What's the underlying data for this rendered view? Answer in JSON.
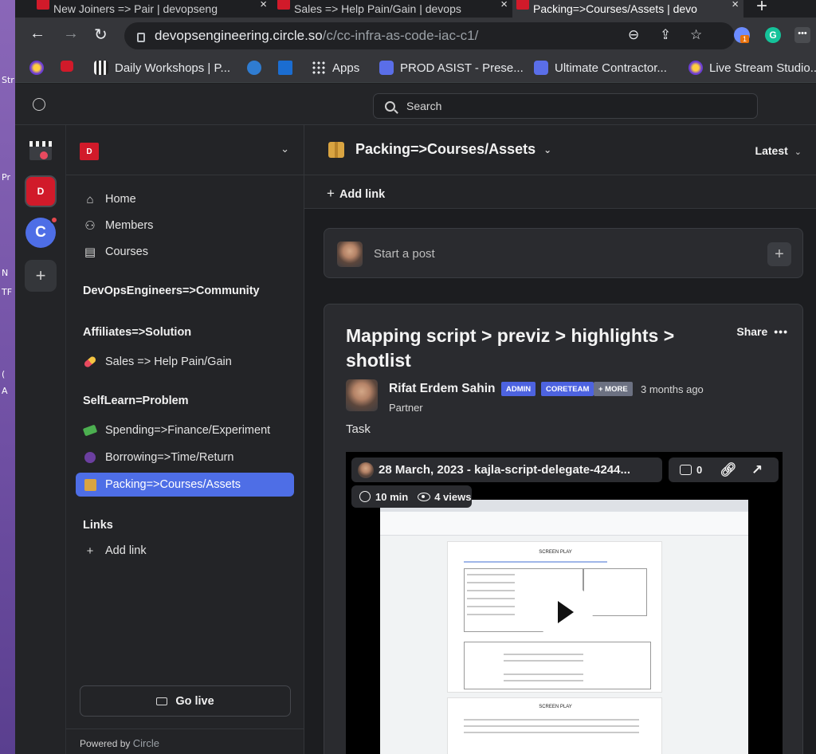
{
  "desktop": {
    "fragments": [
      "Str",
      "Pr",
      "N",
      "TF",
      "(",
      "A"
    ]
  },
  "browser": {
    "tabs": [
      {
        "label": "New Joiners => Pair | devopseng",
        "active": false
      },
      {
        "label": "Sales => Help Pain/Gain | devops",
        "active": false
      },
      {
        "label": "Packing=>Courses/Assets | devo",
        "active": true
      }
    ],
    "url_host": "devopsengineering.circle.so",
    "url_path": "/c/cc-infra-as-code-iac-c1/",
    "bookmarks": [
      {
        "label": "",
        "icon": "youtube-red"
      },
      {
        "label": "Daily Workshops | P...",
        "icon": "clapperboard"
      },
      {
        "label": "",
        "icon": "wordpress"
      },
      {
        "label": "",
        "icon": "blue-square"
      },
      {
        "label": "Apps",
        "icon": "apps-grid"
      },
      {
        "label": "PROD ASIST - Prese...",
        "icon": "bot"
      },
      {
        "label": "Ultimate Contractor...",
        "icon": "bot"
      },
      {
        "label": "Live Stream Studio...",
        "icon": "rocket"
      }
    ],
    "extension_badge": "1"
  },
  "app": {
    "search_label": "Search",
    "rail": [
      {
        "name": "clapper-community",
        "label": ""
      },
      {
        "name": "devops-community",
        "label": ""
      },
      {
        "name": "c-community",
        "label": "C"
      },
      {
        "name": "add-community",
        "label": "+"
      }
    ],
    "sidebar": {
      "nav": [
        {
          "label": "Home",
          "icon": "home-icon"
        },
        {
          "label": "Members",
          "icon": "members-icon"
        },
        {
          "label": "Courses",
          "icon": "courses-icon"
        }
      ],
      "community_title": "DevOpsEngineers=>Community",
      "affiliates_title": "Affiliates=>Solution",
      "sales_item": "Sales => Help Pain/Gain",
      "selflearn_title": "SelfLearn=Problem",
      "spending_item": "Spending=>Finance/Experiment",
      "borrowing_item": "Borrowing=>Time/Return",
      "packing_item": "Packing=>Courses/Assets",
      "links_title": "Links",
      "add_link": "Add link",
      "go_live": "Go live",
      "powered_prefix": "Powered by",
      "powered_brand": "Circle"
    },
    "main": {
      "space_title": "Packing=>Courses/Assets",
      "sort_label": "Latest",
      "add_link": "Add link",
      "composer_placeholder": "Start a post",
      "post": {
        "title": "Mapping script > previz > highlights > shotlist",
        "share_label": "Share",
        "author": "Rifat Erdem Sahin",
        "badges": {
          "admin": "ADMIN",
          "core": "CORETEAM",
          "more": "+ MORE"
        },
        "time_ago": "3 months ago",
        "role": "Partner",
        "body": "Task",
        "video": {
          "title": "28 March, 2023 - kajla-script-delegate-4244...",
          "comments": "0",
          "duration": "10 min",
          "views": "4 views",
          "doc_heading": "SCREEN PLAY"
        }
      }
    }
  }
}
